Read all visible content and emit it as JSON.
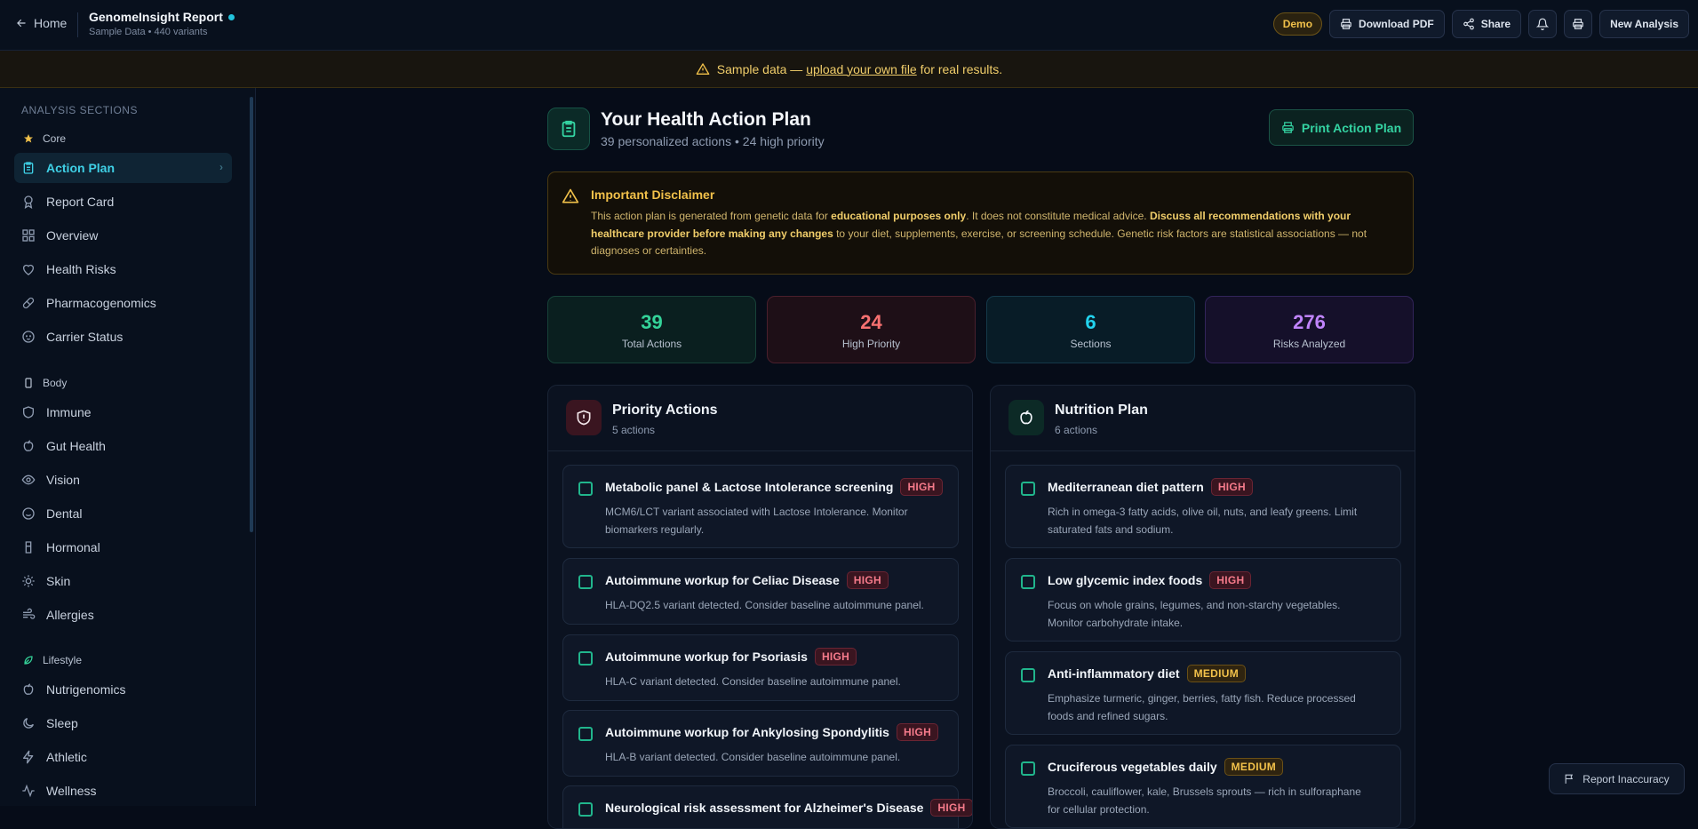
{
  "header": {
    "home_label": "Home",
    "title": "GenomeInsight Report",
    "subtitle": "Sample Data • 440 variants",
    "demo_badge": "Demo",
    "download_label": "Download PDF",
    "share_label": "Share",
    "new_analysis_label": "New Analysis"
  },
  "banner": {
    "prefix": "Sample data — ",
    "link": "upload your own file",
    "suffix": " for real results."
  },
  "sidebar": {
    "heading": "ANALYSIS SECTIONS",
    "groups": [
      {
        "label": "Core",
        "icon": "star-icon",
        "items": [
          {
            "label": "Action Plan",
            "icon": "clipboard-icon",
            "active": true
          },
          {
            "label": "Report Card",
            "icon": "award-icon"
          },
          {
            "label": "Overview",
            "icon": "grid-icon"
          },
          {
            "label": "Health Risks",
            "icon": "heart-icon"
          },
          {
            "label": "Pharmacogenomics",
            "icon": "pill-icon"
          },
          {
            "label": "Carrier Status",
            "icon": "baby-icon"
          }
        ]
      },
      {
        "label": "Body",
        "icon": "body-icon",
        "items": [
          {
            "label": "Immune",
            "icon": "shield-icon"
          },
          {
            "label": "Gut Health",
            "icon": "apple-icon"
          },
          {
            "label": "Vision",
            "icon": "eye-icon"
          },
          {
            "label": "Dental",
            "icon": "smile-icon"
          },
          {
            "label": "Hormonal",
            "icon": "flask-icon"
          },
          {
            "label": "Skin",
            "icon": "sun-icon"
          },
          {
            "label": "Allergies",
            "icon": "wind-icon"
          }
        ]
      },
      {
        "label": "Lifestyle",
        "icon": "leaf-icon",
        "items": [
          {
            "label": "Nutrigenomics",
            "icon": "apple-icon"
          },
          {
            "label": "Sleep",
            "icon": "moon-icon"
          },
          {
            "label": "Athletic",
            "icon": "zap-icon"
          },
          {
            "label": "Wellness",
            "icon": "activity-icon"
          }
        ]
      }
    ]
  },
  "plan": {
    "title": "Your Health Action Plan",
    "subtitle": "39 personalized actions • 24 high priority",
    "print_label": "Print Action Plan"
  },
  "disclaimer": {
    "title": "Important Disclaimer",
    "p1": "This action plan is generated from genetic data for ",
    "b1": "educational purposes only",
    "p2": ". It does not constitute medical advice. ",
    "b2": "Discuss all recommendations with your healthcare provider before making any changes",
    "p3": " to your diet, supplements, exercise, or screening schedule. Genetic risk factors are statistical associations — not diagnoses or certainties."
  },
  "stats": [
    {
      "value": "39",
      "label": "Total Actions",
      "color": "#34d399"
    },
    {
      "value": "24",
      "label": "High Priority",
      "color": "#f87171"
    },
    {
      "value": "6",
      "label": "Sections",
      "color": "#22d3ee"
    },
    {
      "value": "276",
      "label": "Risks Analyzed",
      "color": "#c084fc"
    }
  ],
  "priority": {
    "title": "Priority Actions",
    "count": "5 actions",
    "cards": [
      {
        "title": "Metabolic panel & Lactose Intolerance screening",
        "priority": "HIGH",
        "desc": "MCM6/LCT variant associated with Lactose Intolerance. Monitor biomarkers regularly."
      },
      {
        "title": "Autoimmune workup for Celiac Disease",
        "priority": "HIGH",
        "desc": "HLA-DQ2.5 variant detected. Consider baseline autoimmune panel."
      },
      {
        "title": "Autoimmune workup for Psoriasis",
        "priority": "HIGH",
        "desc": "HLA-C variant detected. Consider baseline autoimmune panel."
      },
      {
        "title": "Autoimmune workup for Ankylosing Spondylitis",
        "priority": "HIGH",
        "desc": "HLA-B variant detected. Consider baseline autoimmune panel."
      },
      {
        "title": "Neurological risk assessment for Alzheimer's Disease",
        "priority": "HIGH",
        "desc": ""
      }
    ]
  },
  "nutrition": {
    "title": "Nutrition Plan",
    "count": "6 actions",
    "cards": [
      {
        "title": "Mediterranean diet pattern",
        "priority": "HIGH",
        "desc": "Rich in omega-3 fatty acids, olive oil, nuts, and leafy greens. Limit saturated fats and sodium."
      },
      {
        "title": "Low glycemic index foods",
        "priority": "HIGH",
        "desc": "Focus on whole grains, legumes, and non-starchy vegetables. Monitor carbohydrate intake."
      },
      {
        "title": "Anti-inflammatory diet",
        "priority": "MEDIUM",
        "desc": "Emphasize turmeric, ginger, berries, fatty fish. Reduce processed foods and refined sugars."
      },
      {
        "title": "Cruciferous vegetables daily",
        "priority": "MEDIUM",
        "desc": "Broccoli, cauliflower, kale, Brussels sprouts — rich in sulforaphane for cellular protection."
      }
    ]
  },
  "report_label": "Report Inaccuracy"
}
